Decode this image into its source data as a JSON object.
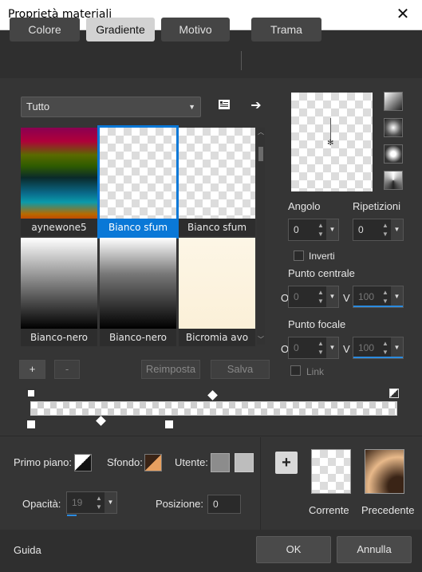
{
  "window": {
    "title": "Proprietà materiali",
    "close_glyph": "✕"
  },
  "tabs": [
    {
      "label": "Colore"
    },
    {
      "label": "Gradiente"
    },
    {
      "label": "Motivo"
    },
    {
      "label": "Trama"
    }
  ],
  "filter": {
    "value": "Tutto"
  },
  "gallery": [
    {
      "label": "aynewone5",
      "selected": false
    },
    {
      "label": "Bianco sfum",
      "selected": true
    },
    {
      "label": "Bianco sfum",
      "selected": false
    },
    {
      "label": "Bianco-nero",
      "selected": false
    },
    {
      "label": "Bianco-nero",
      "selected": false
    },
    {
      "label": "Bicromia avo",
      "selected": false
    }
  ],
  "gallery_actions": {
    "add": "+",
    "remove": "-",
    "reset": "Reimposta",
    "save": "Salva"
  },
  "angle": {
    "label": "Angolo",
    "value": "0"
  },
  "repeats": {
    "label": "Ripetizioni",
    "value": "0"
  },
  "invert": {
    "label": "Inverti",
    "checked": false
  },
  "center_point": {
    "label": "Punto centrale",
    "o_label": "O",
    "o_value": "0",
    "v_label": "V",
    "v_value": "100"
  },
  "focal_point": {
    "label": "Punto focale",
    "o_label": "O",
    "o_value": "0",
    "v_label": "V",
    "v_value": "100"
  },
  "link": {
    "label": "Link"
  },
  "bottom": {
    "foreground_label": "Primo piano:",
    "background_label": "Sfondo:",
    "user_label": "Utente:",
    "opacity_label": "Opacità:",
    "opacity_value": "19",
    "position_label": "Posizione:",
    "position_value": "0",
    "current_label": "Corrente",
    "previous_label": "Precedente",
    "add_glyph": "+"
  },
  "footer": {
    "help": "Guida",
    "ok": "OK",
    "cancel": "Annulla"
  },
  "colors": {
    "accent": "#0a78d7",
    "previous_swatch_center": "#3a2416",
    "previous_swatch_edge": "#e8b98a"
  }
}
